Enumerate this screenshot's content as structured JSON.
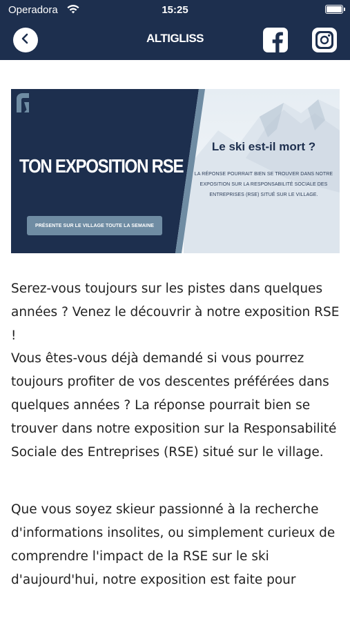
{
  "status_bar": {
    "carrier": "Operadora",
    "time": "15:25"
  },
  "nav": {
    "logo_text": "ALTIGLISS",
    "back_icon": "chevron-left-icon",
    "facebook_icon": "facebook-icon",
    "instagram_icon": "instagram-icon",
    "bar_color": "#1d2f4e"
  },
  "banner": {
    "title": "TON EXPOSITION RSE",
    "pill_label": "PRÉSENTE SUR LE VILLAGE TOUTE LA SEMAINE",
    "question": "Le ski est-il mort ?",
    "subtext": "LA RÉPONSE POURRAIT BIEN SE TROUVER DANS NOTRE EXPOSITION SUR LA RESPONSABILITÉ SOCIALE DES ENTREPRISES (RSE) SITUÉ SUR LE VILLAGE.",
    "left_color": "#1d2f4e",
    "accent_color": "#6f8ca3"
  },
  "article": {
    "paragraph_1": "Serez-vous toujours sur les pistes dans quelques années ? Venez le découvrir à notre exposition RSE !",
    "paragraph_2": "Vous êtes-vous déjà demandé si vous pourrez toujours profiter de vos descentes préférées dans quelques années ? La réponse pourrait bien se trouver dans notre exposition sur la Responsabilité Sociale des Entreprises (RSE) situé sur le village.",
    "paragraph_3": "Que vous soyez skieur passionné à la recherche d'informations insolites, ou simplement curieux de comprendre l'impact de la RSE sur le ski d'aujourd'hui, notre exposition est faite pour"
  }
}
